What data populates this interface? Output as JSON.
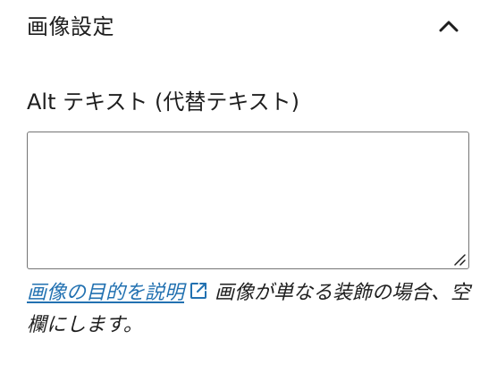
{
  "panel": {
    "title": "画像設定",
    "toggle_icon": "chevron-up-icon"
  },
  "alt_field": {
    "label": "Alt テキスト (代替テキスト)",
    "value": "",
    "placeholder": ""
  },
  "help": {
    "link_text": "画像の目的を説明",
    "link_icon": "external-link-icon",
    "text": "画像が単なる装飾の場合、空欄にします。"
  },
  "colors": {
    "link": "#2271b1",
    "text": "#1e1e1e",
    "border": "#757575"
  }
}
